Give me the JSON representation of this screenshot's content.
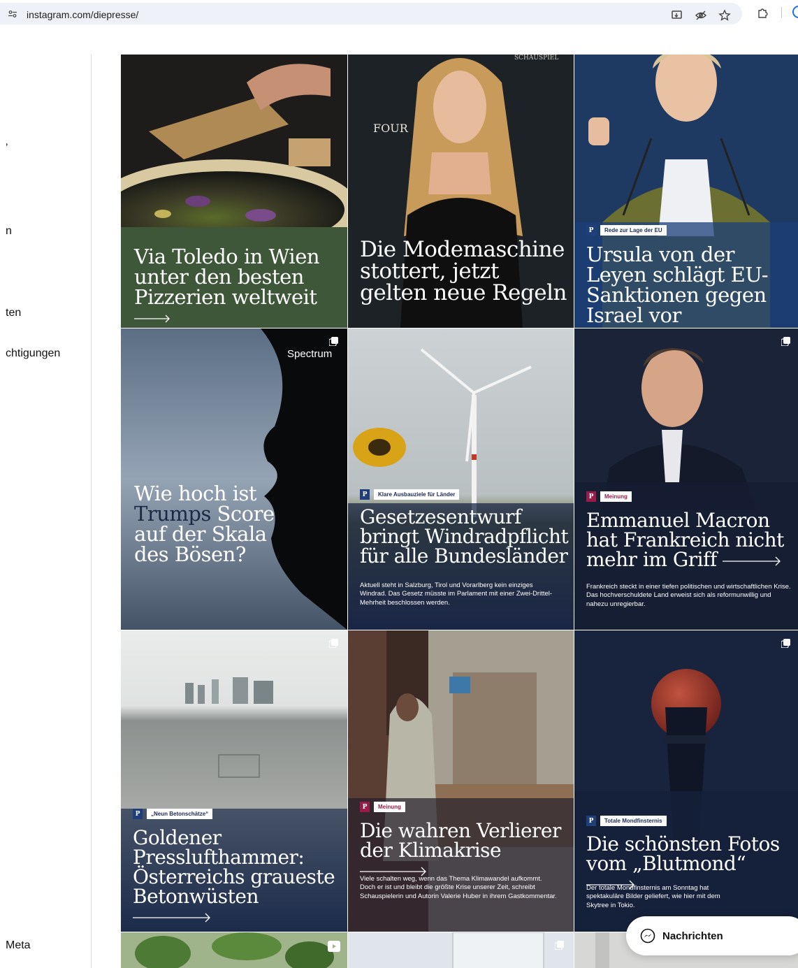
{
  "browser": {
    "url": "instagram.com/diepresse/"
  },
  "sidebar": {
    "items": [
      {
        "label": "ʼ"
      },
      {
        "label": "n"
      },
      {
        "label": "ten"
      },
      {
        "label": "chtigungen"
      },
      {
        "label": "Meta"
      }
    ]
  },
  "posts": [
    {
      "title": "Via Toledo in Wien unter den besten Pizzerien weltweit",
      "badge": "",
      "subtitle": ""
    },
    {
      "title": "Die Modemaschine stottert, jetzt gelten neue Regeln",
      "badge": "",
      "subtitle": "",
      "overlay_text_1": "FOUR",
      "overlay_text_2": "SCHAUSPIEL"
    },
    {
      "title": "Ursula von der Leyen schlägt EU-Sanktionen gegen Israel vor",
      "badge": "Rede zur Lage der EU",
      "subtitle": ""
    },
    {
      "title_part1": "Wie hoch ist ",
      "title_highlight": "Trumps",
      "title_part2": " Score auf der Skala des Bösen?",
      "badge": "",
      "subtitle": "",
      "brand": "Spectrum"
    },
    {
      "title": "Gesetzesentwurf bringt Windradpflicht für alle Bundesländer",
      "badge": "Klare Ausbauziele für Länder",
      "subtitle": "Aktuell steht in Salzburg, Tirol und Vorarlberg kein einziges Windrad. Das Gesetz müsste im Parlament mit einer Zwei-Drittel-Mehrheit beschlossen werden."
    },
    {
      "title": "Emmanuel Macron hat Frankreich nicht mehr im Griff",
      "badge": "Meinung",
      "subtitle": "Frankreich steckt in einer tiefen politischen und wirtschaftlichen Krise. Das hochverschuldete Land erweist sich als reformunwillig und nahezu unregierbar."
    },
    {
      "title": "Goldener Presslufthammer: Österreichs graueste Betonwüsten",
      "badge": "„Neun Betonschätze“",
      "subtitle": ""
    },
    {
      "title": "Die wahren Verlierer der Klimakrise",
      "badge": "Meinung",
      "subtitle": "Viele schalten weg, wenn das Thema Klimawandel aufkommt. Doch er ist und bleibt die größte Krise unserer Zeit, schreibt Schauspielerin und Autorin Valerie Huber in ihrem Gastkommentar."
    },
    {
      "title": "Die schönsten Fotos vom „Blutmond“",
      "badge": "Totale Mondfinsternis",
      "subtitle": "Der totale Mondfinsternis am Sonntag hat spektakuläre Bilder geliefert, wie hier mit dem Skytree in Tokio."
    }
  ],
  "badge_letter": "P",
  "messages": {
    "label": "Nachrichten"
  },
  "colors": {
    "accent_blue": "#1f3f7a",
    "accent_red": "#9a1b48",
    "browser_bar": "#eef1f7"
  }
}
